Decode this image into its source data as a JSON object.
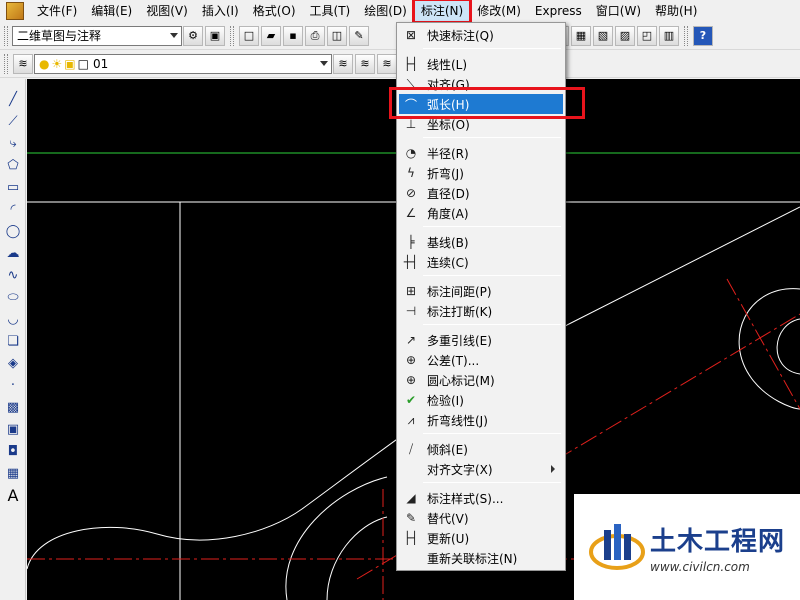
{
  "menubar": {
    "items": [
      "文件(F)",
      "编辑(E)",
      "视图(V)",
      "插入(I)",
      "格式(O)",
      "工具(T)",
      "绘图(D)",
      "标注(N)",
      "修改(M)",
      "Express",
      "窗口(W)",
      "帮助(H)"
    ]
  },
  "toolbar1": {
    "workspace": "二维草图与注释"
  },
  "toolbar2": {
    "layer": "01"
  },
  "dimension_menu": {
    "items": [
      {
        "label": "快速标注(Q)",
        "icon": "quick-dimension-icon"
      },
      {
        "label": "线性(L)",
        "icon": "linear-dimension-icon"
      },
      {
        "label": "对齐(G)",
        "icon": "aligned-dimension-icon"
      },
      {
        "label": "弧长(H)",
        "icon": "arc-length-icon"
      },
      {
        "label": "坐标(O)",
        "icon": "ordinate-dimension-icon"
      },
      {
        "label": "半径(R)",
        "icon": "radius-dimension-icon"
      },
      {
        "label": "折弯(J)",
        "icon": "jogged-dimension-icon"
      },
      {
        "label": "直径(D)",
        "icon": "diameter-dimension-icon"
      },
      {
        "label": "角度(A)",
        "icon": "angular-dimension-icon"
      },
      {
        "label": "基线(B)",
        "icon": "baseline-dimension-icon"
      },
      {
        "label": "连续(C)",
        "icon": "continue-dimension-icon"
      },
      {
        "label": "标注间距(P)",
        "icon": "dimension-space-icon"
      },
      {
        "label": "标注打断(K)",
        "icon": "dimension-break-icon"
      },
      {
        "label": "多重引线(E)",
        "icon": "multileader-icon"
      },
      {
        "label": "公差(T)...",
        "icon": "tolerance-icon"
      },
      {
        "label": "圆心标记(M)",
        "icon": "center-mark-icon"
      },
      {
        "label": "检验(I)",
        "icon": "inspection-icon"
      },
      {
        "label": "折弯线性(J)",
        "icon": "jogged-linear-icon"
      },
      {
        "label": "倾斜(E)",
        "icon": "oblique-icon"
      },
      {
        "label": "对齐文字(X)",
        "icon": ""
      },
      {
        "label": "标注样式(S)...",
        "icon": "dimension-style-icon"
      },
      {
        "label": "替代(V)",
        "icon": "override-icon"
      },
      {
        "label": "更新(U)",
        "icon": "update-icon"
      },
      {
        "label": "重新关联标注(N)",
        "icon": ""
      }
    ],
    "selected": "弧长(H)"
  },
  "watermark": {
    "name": "土木工程网",
    "url": "www.civilcn.com"
  },
  "colors": {
    "menu_highlight": "#1e7ad2",
    "annotation_red": "#e8141c",
    "centerline_red": "#e0201c",
    "crosshair_green": "#2cd23a"
  }
}
